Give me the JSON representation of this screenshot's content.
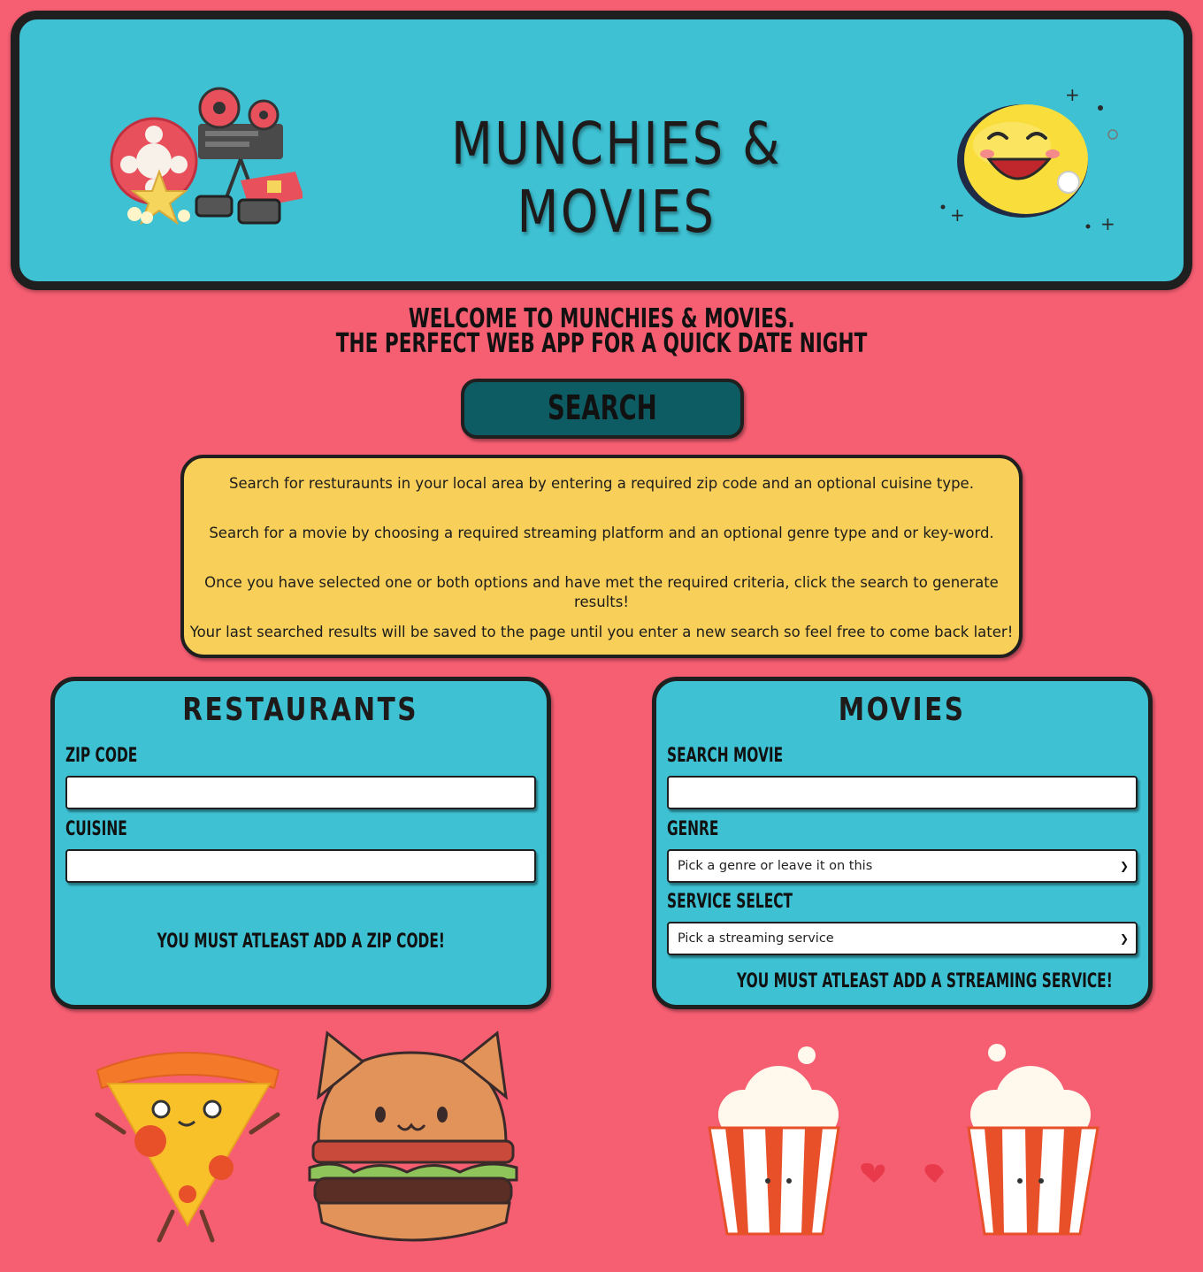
{
  "header": {
    "title": "MUNCHIES & MOVIES"
  },
  "welcome": {
    "line1": "WELCOME TO MUNCHIES & MOVIES.",
    "line2": "THE PERFECT WEB APP FOR A QUICK DATE NIGHT"
  },
  "search_button": {
    "label": "SEARCH"
  },
  "info": {
    "p1": "Search for resturaunts in your local area by entering a required zip code and an optional cuisine type.",
    "p2": "Search for a movie by choosing a required streaming platform and an optional genre type and or key-word.",
    "p3": "Once you have selected one or both options and have met the required criteria, click the search to generate results!",
    "p4": "Your last searched results will be saved to the page until you enter a new search so feel free to come back later!"
  },
  "restaurants": {
    "title": "RESTAURANTS",
    "zip_label": "ZIP CODE",
    "zip_value": "",
    "cuisine_label": "CUISINE",
    "cuisine_value": "",
    "warning": "YOU MUST ATLEAST ADD A ZIP CODE!"
  },
  "movies": {
    "title": "MOVIES",
    "search_label": "SEARCH MOVIE",
    "search_value": "",
    "genre_label": "GENRE",
    "genre_selected": "Pick a genre or leave it on this",
    "service_label": "SERVICE SELECT",
    "service_selected": "Pick a streaming service",
    "warning": "YOU MUST ATLEAST ADD A STREAMING SERVICE!"
  },
  "colors": {
    "background": "#f65e72",
    "panel": "#3dc1d3",
    "info": "#f8cf58",
    "search_button": "#0d5c63",
    "border": "#1f1f1f"
  },
  "icons": [
    "film-projector-icon",
    "smiley-face-icon",
    "pizza-slice-icon",
    "cat-burger-icon",
    "popcorn-left-icon",
    "popcorn-right-icon",
    "chevron-down-icon"
  ]
}
